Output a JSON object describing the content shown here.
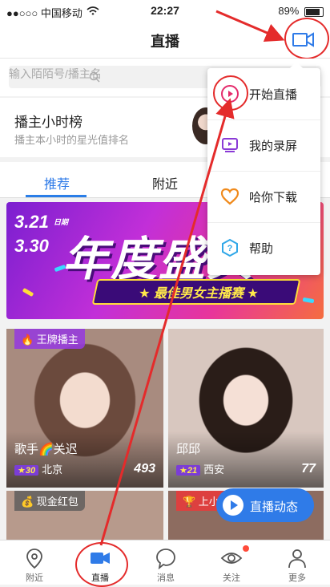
{
  "status": {
    "carrier": "●●○○○ 中国移动",
    "time": "22:27",
    "battery": "89%"
  },
  "nav": {
    "title": "直播"
  },
  "search": {
    "placeholder": "输入陌陌号/播主名"
  },
  "rank": {
    "title": "播主小时榜",
    "subtitle": "播主本小时的星光值排名"
  },
  "tabs": [
    {
      "label": "推荐"
    },
    {
      "label": "附近"
    }
  ],
  "banner": {
    "date1": "3.21",
    "date2": "3.30",
    "day_char": "日期",
    "headline": "年度盛典",
    "sub": "★ 最佳男女主播赛 ★"
  },
  "cards": [
    {
      "badge": "🔥 王牌播主",
      "name": "歌手🌈关迟",
      "level": "30",
      "city": "北京",
      "count": "493"
    },
    {
      "badge": "",
      "name": "邱邱",
      "level": "21",
      "city": "西安",
      "count": "77"
    },
    {
      "badge": "💰 现金红包",
      "name": "",
      "level": "",
      "city": "",
      "count": ""
    },
    {
      "badge": "🏆 上小",
      "name": "",
      "level": "",
      "city": "",
      "count": ""
    }
  ],
  "live_fab": {
    "label": "直播动态"
  },
  "menu": [
    {
      "label": "开始直播",
      "icon": "play-icon"
    },
    {
      "label": "我的录屏",
      "icon": "screen-record-icon"
    },
    {
      "label": "哈你下载",
      "icon": "heart-download-icon"
    },
    {
      "label": "帮助",
      "icon": "help-icon"
    }
  ],
  "bottom_nav": [
    {
      "label": "附近",
      "icon": "location-icon"
    },
    {
      "label": "直播",
      "icon": "video-camera-icon"
    },
    {
      "label": "消息",
      "icon": "chat-icon"
    },
    {
      "label": "关注",
      "icon": "eye-icon"
    },
    {
      "label": "更多",
      "icon": "person-icon"
    }
  ],
  "colors": {
    "accent": "#2f7be8",
    "annotation": "#e42b2b"
  }
}
